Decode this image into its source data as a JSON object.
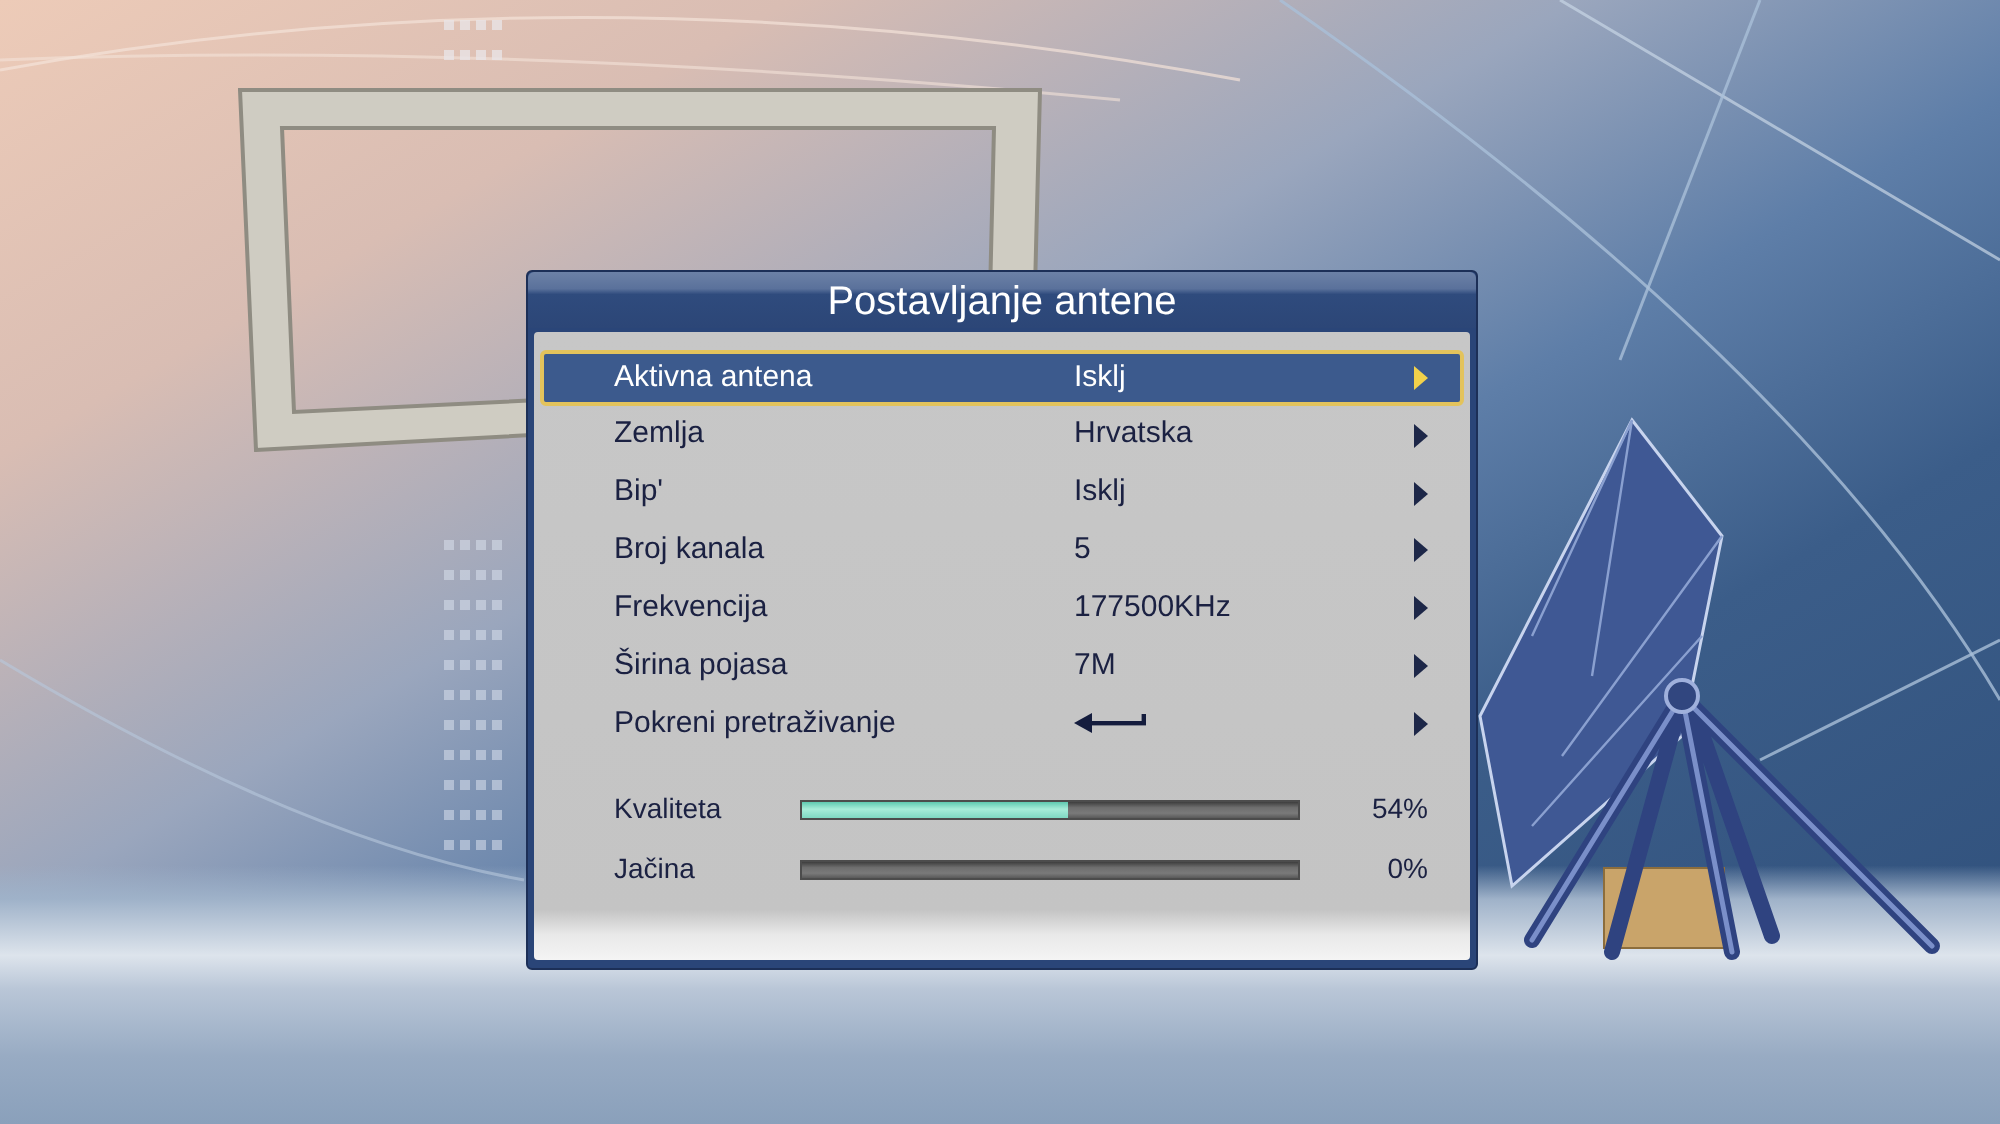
{
  "dialog": {
    "title": "Postavljanje antene",
    "rows": [
      {
        "label": "Aktivna antena",
        "kind": "value",
        "value": "Isklj",
        "selected": true
      },
      {
        "label": "Zemlja",
        "kind": "value",
        "value": "Hrvatska",
        "selected": false
      },
      {
        "label": "Bip'",
        "kind": "value",
        "value": "Isklj",
        "selected": false
      },
      {
        "label": "Broj kanala",
        "kind": "value",
        "value": "5",
        "selected": false
      },
      {
        "label": "Frekvencija",
        "kind": "value",
        "value": "177500KHz",
        "selected": false
      },
      {
        "label": "Širina pojasa",
        "kind": "value",
        "value": "7M",
        "selected": false
      },
      {
        "label": "Pokreni pretraživanje",
        "kind": "enter",
        "selected": false
      }
    ],
    "meters": [
      {
        "label": "Kvaliteta",
        "level": 0.54,
        "reading": "54%"
      },
      {
        "label": "Jačina",
        "level": 0,
        "reading": "0%"
      }
    ]
  }
}
